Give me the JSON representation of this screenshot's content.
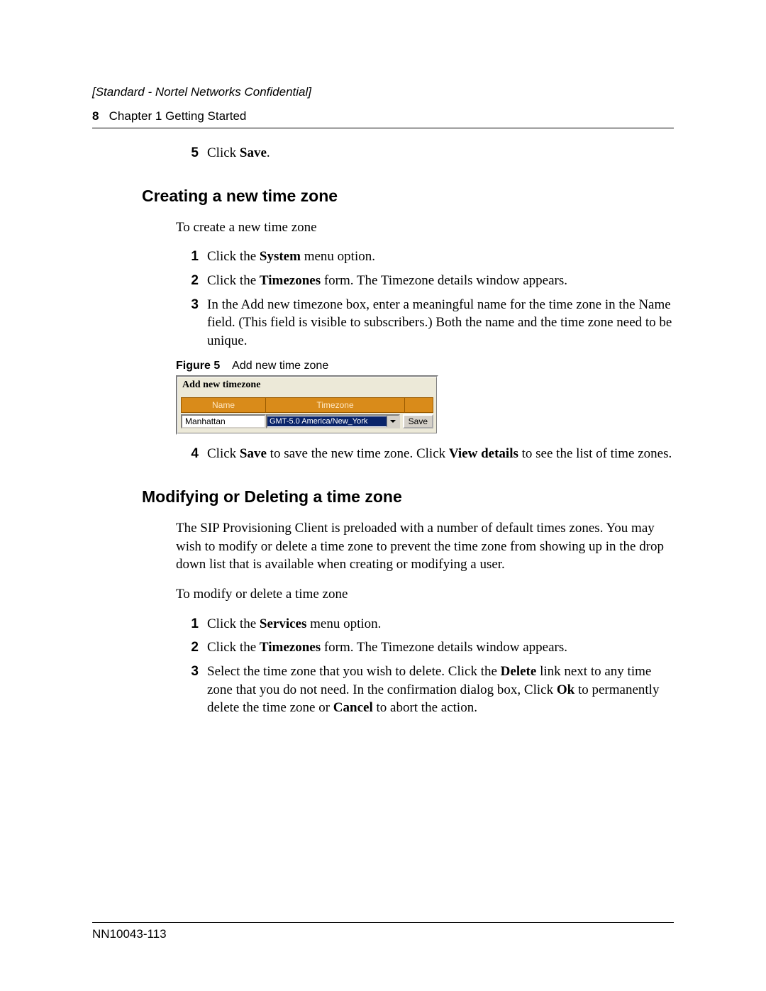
{
  "header": {
    "classification": "[Standard - Nortel Networks Confidential]",
    "page_number": "8",
    "chapter_label": "Chapter 1  Getting Started"
  },
  "pre_step": {
    "num": "5",
    "lead": "Click ",
    "bold": "Save",
    "tail": "."
  },
  "section_a": {
    "heading": "Creating a new time zone",
    "intro": "To create a new time zone",
    "steps": [
      {
        "num": "1",
        "parts": [
          {
            "t": "Click the "
          },
          {
            "t": "System",
            "b": true
          },
          {
            "t": " menu option."
          }
        ]
      },
      {
        "num": "2",
        "parts": [
          {
            "t": "Click the "
          },
          {
            "t": "Timezones",
            "b": true
          },
          {
            "t": " form. The Timezone details window appears."
          }
        ]
      },
      {
        "num": "3",
        "parts": [
          {
            "t": "In the Add new timezone box, enter a meaningful name for the time zone in the Name field. (This field is visible to subscribers.) Both the name and the time zone need to be unique."
          }
        ]
      }
    ],
    "figure": {
      "label": "Figure 5",
      "caption": "Add new time zone",
      "panel_title": "Add new timezone",
      "col_name": "Name",
      "col_tz": "Timezone",
      "name_value": "Manhattan",
      "tz_value": "GMT-5.0 America/New_York",
      "save_label": "Save"
    },
    "steps_after": [
      {
        "num": "4",
        "parts": [
          {
            "t": "Click "
          },
          {
            "t": "Save",
            "b": true
          },
          {
            "t": " to save the new time zone. Click "
          },
          {
            "t": "View details",
            "b": true
          },
          {
            "t": " to see the list of time zones."
          }
        ]
      }
    ]
  },
  "section_b": {
    "heading": "Modifying or Deleting a time zone",
    "para": "The SIP Provisioning Client is preloaded with a number of default times zones. You may wish to modify or delete a time zone to prevent the time zone from showing up in the drop down list that is available when creating or modifying a user.",
    "intro": "To modify or delete a time zone",
    "steps": [
      {
        "num": "1",
        "parts": [
          {
            "t": "Click the "
          },
          {
            "t": "Services",
            "b": true
          },
          {
            "t": " menu option."
          }
        ]
      },
      {
        "num": "2",
        "parts": [
          {
            "t": "Click the "
          },
          {
            "t": "Timezones",
            "b": true
          },
          {
            "t": " form. The Timezone details window appears."
          }
        ]
      },
      {
        "num": "3",
        "parts": [
          {
            "t": "Select the time zone that you wish to delete. Click the "
          },
          {
            "t": "Delete",
            "b": true
          },
          {
            "t": " link next to any time zone that you do not need. In the confirmation dialog box, Click "
          },
          {
            "t": "Ok",
            "b": true
          },
          {
            "t": " to permanently delete the time zone or "
          },
          {
            "t": "Cancel",
            "b": true
          },
          {
            "t": " to abort the action."
          }
        ]
      }
    ]
  },
  "footer": {
    "doc_id": "NN10043-113"
  }
}
